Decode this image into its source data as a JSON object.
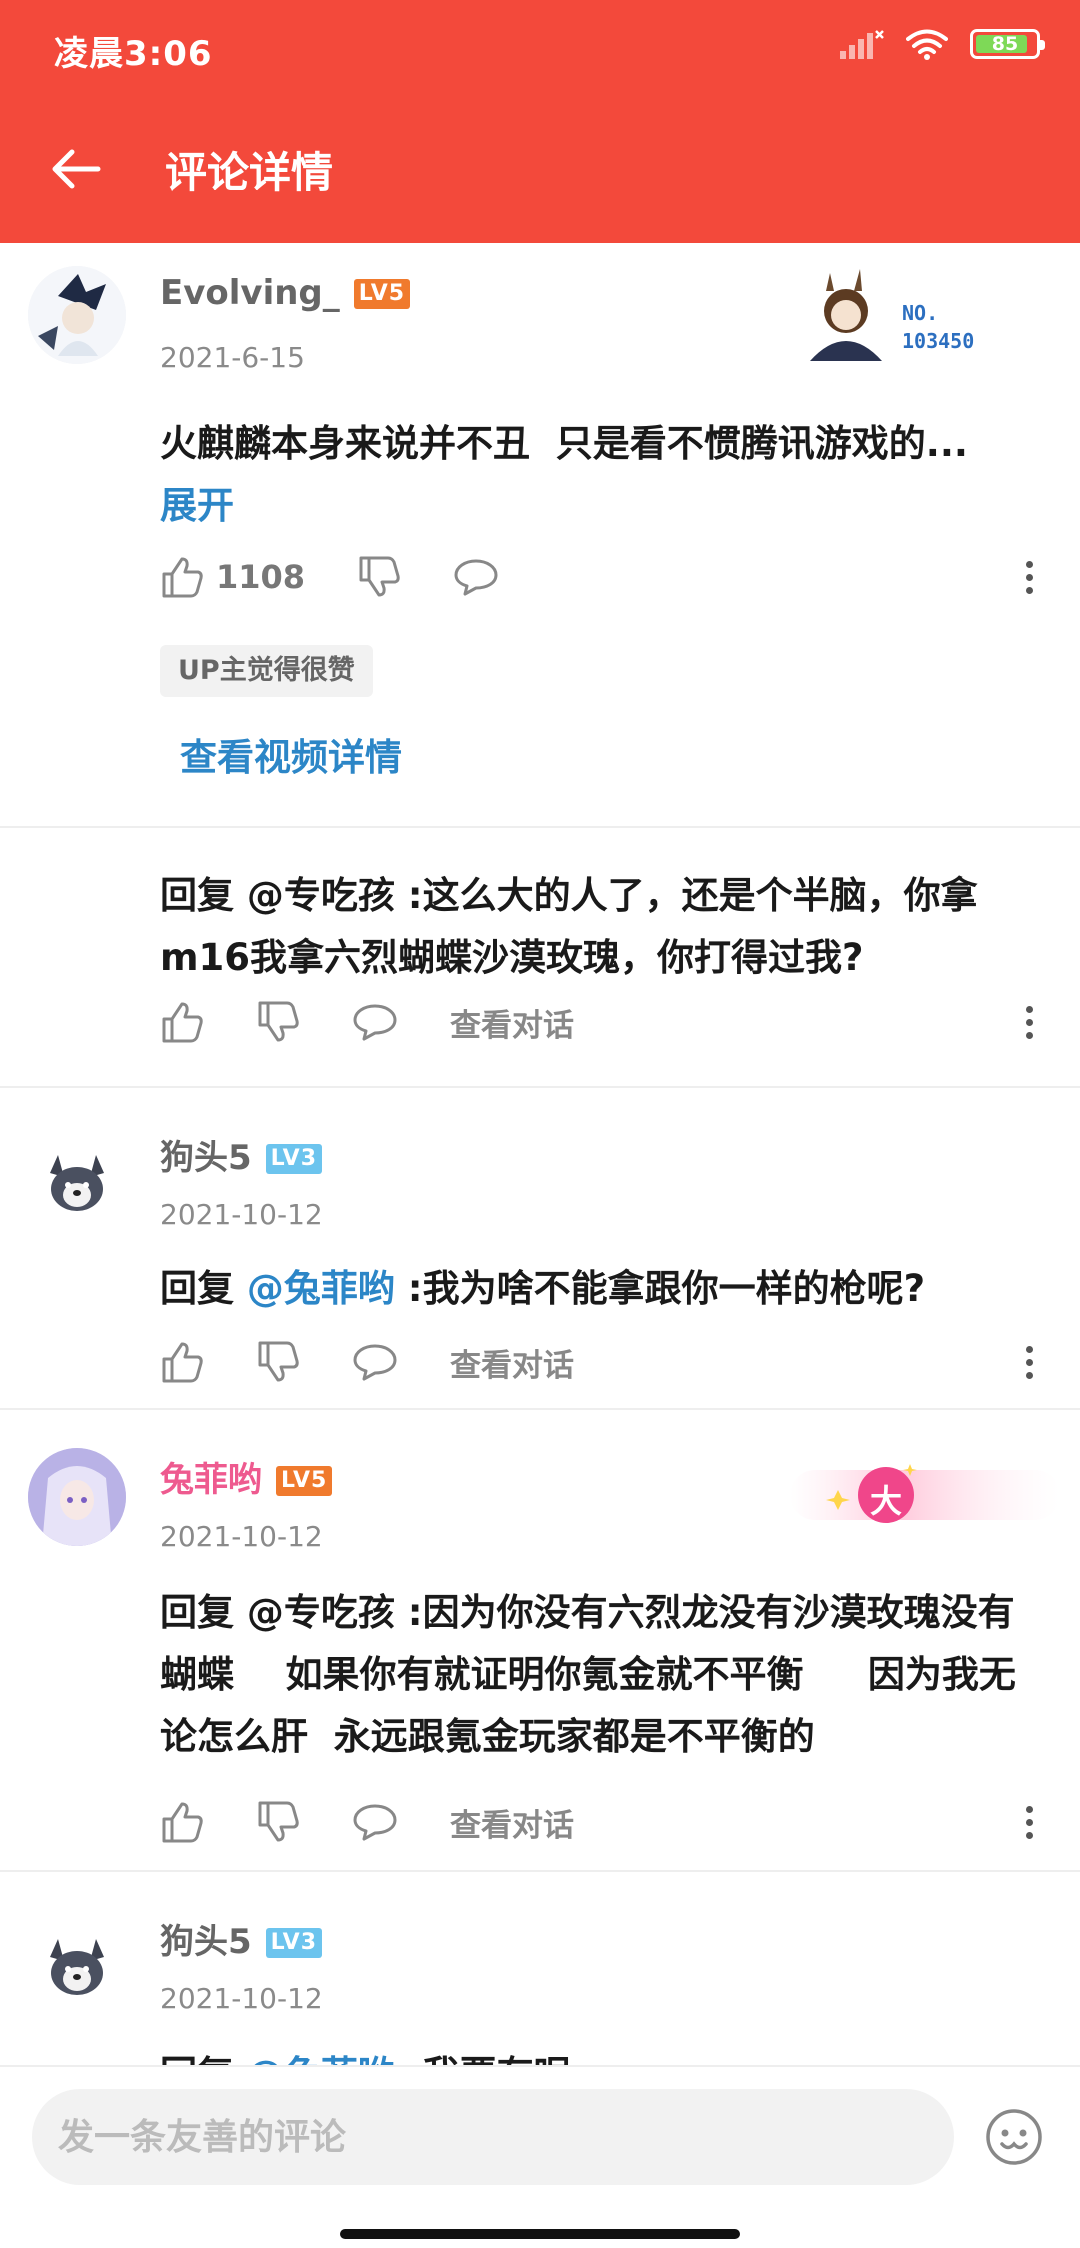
{
  "status_bar": {
    "time": "凌晨3:06",
    "battery": "85"
  },
  "app_bar": {
    "title": "评论详情"
  },
  "comments": [
    {
      "username": "Evolving_",
      "level": "LV5",
      "date": "2021-6-15",
      "badge": "NO.\n103450",
      "content": "火麒麟本身来说并不丑  只是看不惯腾讯游戏的...",
      "expand": "展开",
      "like_count": "1108",
      "up_tag": "UP主觉得很赞",
      "view_video": "查看视频详情"
    },
    {
      "reply_prefix": "回复 ",
      "mention": "@专吃孩",
      "content": " :这么大的人了，还是个半脑，你拿m16我拿六烈蝴蝶沙漠玫瑰，你打得过我?",
      "view_dialog": "查看对话"
    },
    {
      "username": "狗头5",
      "level": "LV3",
      "date": "2021-10-12",
      "reply_prefix": "回复 ",
      "mention": "@兔菲哟",
      "content": " :我为啥不能拿跟你一样的枪呢?",
      "view_dialog": "查看对话"
    },
    {
      "username": "兔菲哟",
      "level": "LV5",
      "date": "2021-10-12",
      "decoration": "大",
      "reply_prefix": "回复 ",
      "mention": "@专吃孩",
      "content": " :因为你没有六烈龙没有沙漠玫瑰没有蝴蝶    如果你有就证明你氪金就不平衡     因为我无论怎么肝  永远跟氪金玩家都是不平衡的",
      "view_dialog": "查看对话"
    },
    {
      "username": "狗头5",
      "level": "LV3",
      "date": "2021-10-12",
      "reply_prefix": "回复 ",
      "mention": "@兔菲哟",
      "content": " :我要有呢"
    }
  ],
  "input": {
    "placeholder": "发一条友善的评论"
  },
  "colors": {
    "header": "#f3493b",
    "link": "#2c86c7",
    "pink_name": "#ee5a8f"
  }
}
